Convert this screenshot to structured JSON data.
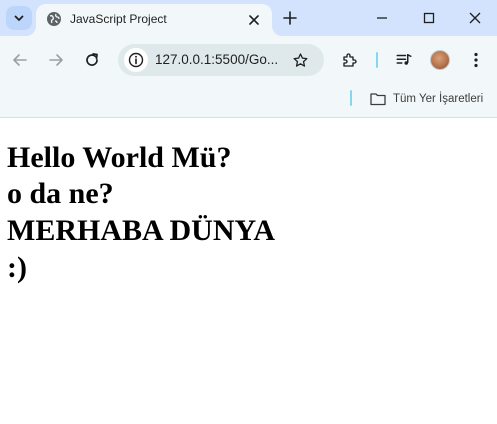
{
  "browser": {
    "tab": {
      "title": "JavaScript Project"
    },
    "address_bar": {
      "url": "127.0.0.1:5500/Go..."
    },
    "bookmarks_bar": {
      "folder_label": "Tüm Yer İşaretleri"
    },
    "icons": {
      "tab_search": "chevron-down-icon",
      "favicon": "globe-icon",
      "tab_close": "close-icon",
      "new_tab": "plus-icon",
      "minimize": "minimize-icon",
      "maximize": "maximize-icon",
      "close_window": "close-icon",
      "back": "arrow-left-icon",
      "forward": "arrow-right-icon",
      "reload": "reload-icon",
      "site_info": "info-icon",
      "bookmark_star": "star-icon",
      "extensions": "puzzle-icon",
      "media": "media-queue-icon",
      "menu": "kebab-menu-icon",
      "folder": "folder-icon"
    },
    "colors": {
      "tabstrip": "#d3e3fd",
      "toolbar": "#f2f8f9",
      "omnibox": "#dfe9ec",
      "accent_divider": "#87d6f0"
    }
  },
  "page": {
    "lines": [
      "Hello World Mü?",
      "o da ne?",
      "MERHABA DÜNYA",
      ":)"
    ]
  }
}
